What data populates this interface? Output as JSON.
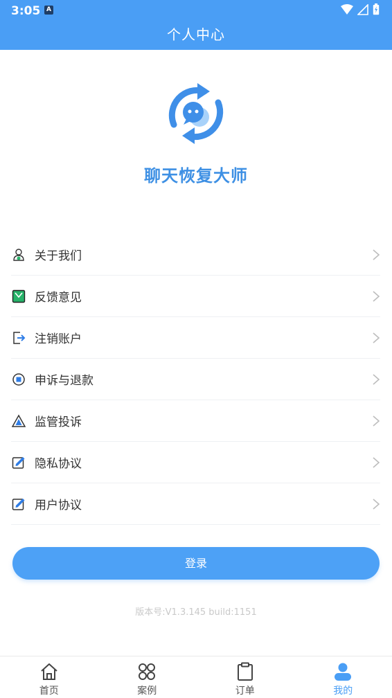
{
  "status_bar": {
    "time": "3:05",
    "badge": "A"
  },
  "header": {
    "title": "个人中心",
    "bg_color": "#4a9ef5"
  },
  "logo": {
    "icon": "chat-sync-icon",
    "app_name": "聊天恢复大师"
  },
  "menu": [
    {
      "icon": "about-icon",
      "label": "关于我们"
    },
    {
      "icon": "feedback-icon",
      "label": "反馈意见"
    },
    {
      "icon": "logout-icon",
      "label": "注销账户"
    },
    {
      "icon": "appeal-icon",
      "label": "申诉与退款"
    },
    {
      "icon": "warning-icon",
      "label": "监管投诉"
    },
    {
      "icon": "edit-doc-icon",
      "label": "隐私协议"
    },
    {
      "icon": "edit-doc-icon",
      "label": "用户协议"
    }
  ],
  "login_button": {
    "label": "登录",
    "color": "#4da1f6"
  },
  "version": "版本号:V1.3.145 build:1151",
  "bottom_nav": [
    {
      "icon": "home-icon",
      "label": "首页",
      "active": false
    },
    {
      "icon": "grid-icon",
      "label": "案例",
      "active": false
    },
    {
      "icon": "clipboard-icon",
      "label": "订单",
      "active": false
    },
    {
      "icon": "user-icon",
      "label": "我的",
      "active": true
    }
  ]
}
